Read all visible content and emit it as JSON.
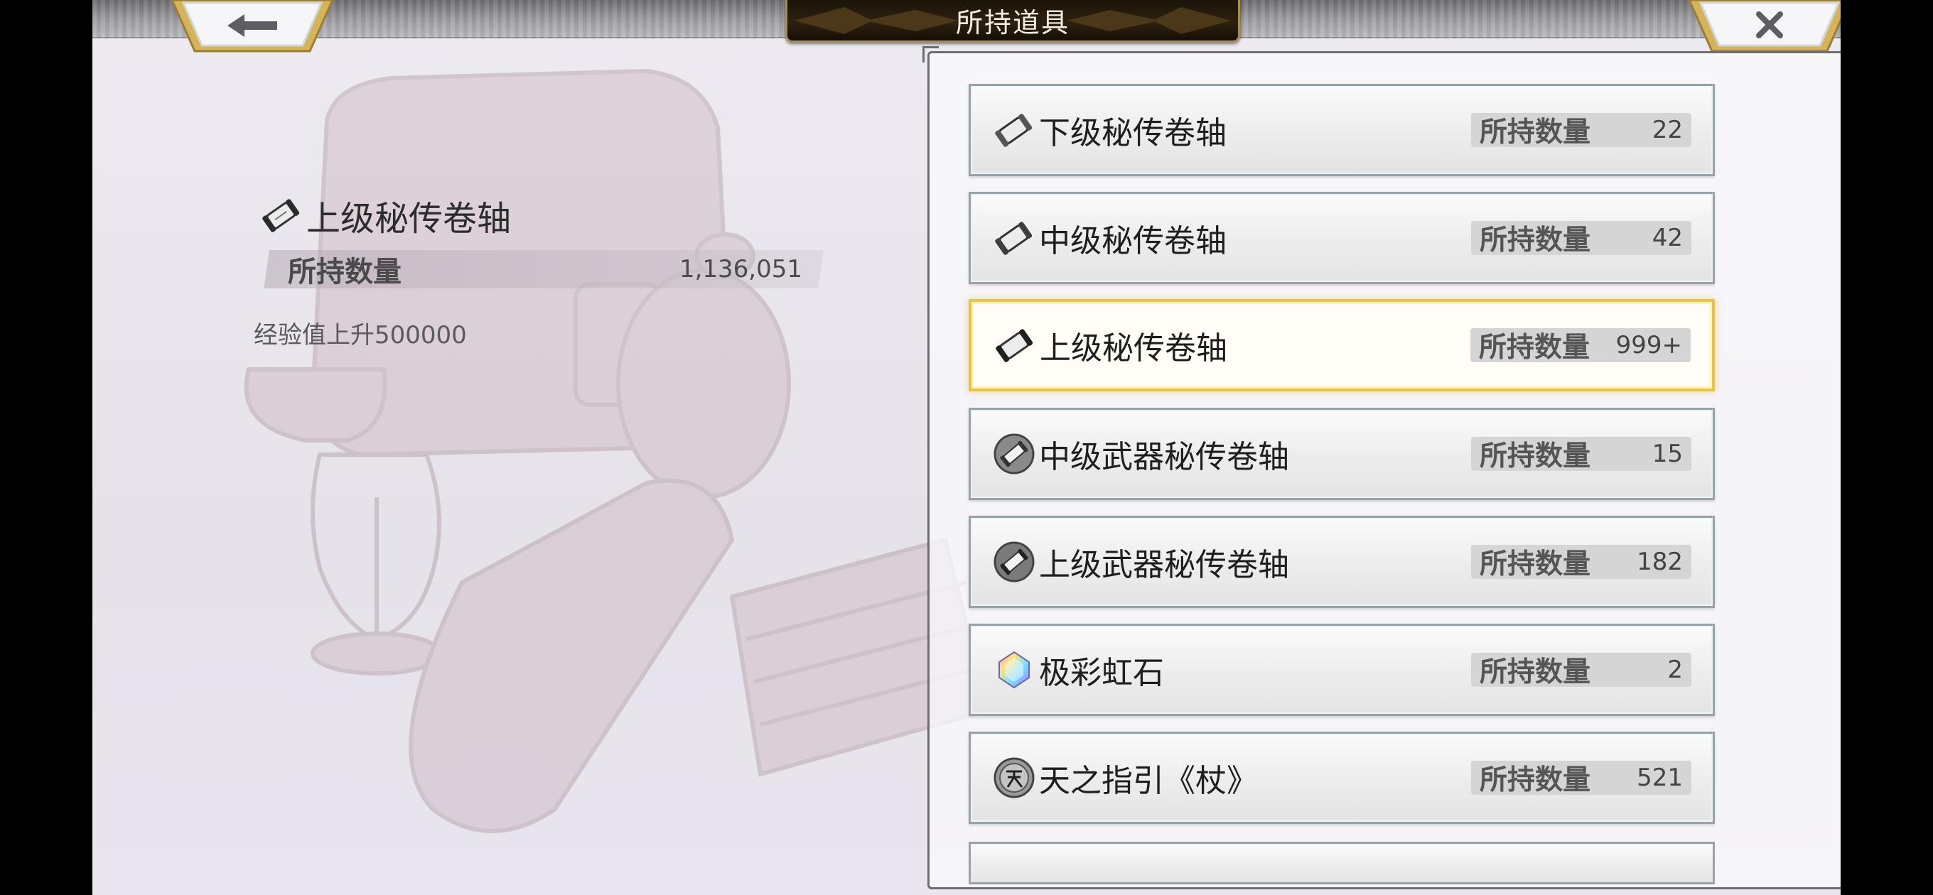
{
  "header": {
    "title": "所持道具",
    "back_icon": "back-arrow-icon",
    "close_icon": "close-x-icon"
  },
  "detail": {
    "icon": "scroll-icon",
    "name": "上级秘传卷轴",
    "qty_label": "所持数量",
    "qty_value": "1,136,051",
    "description": "经验值上升500000"
  },
  "items": [
    {
      "icon": "scroll-icon",
      "name": "下级秘传卷轴",
      "qty_label": "所持数量",
      "qty": "22"
    },
    {
      "icon": "scroll-icon",
      "name": "中级秘传卷轴",
      "qty_label": "所持数量",
      "qty": "42"
    },
    {
      "icon": "scroll-icon",
      "name": "上级秘传卷轴",
      "qty_label": "所持数量",
      "qty": "999+",
      "selected": true
    },
    {
      "icon": "weapon-scroll-icon",
      "name": "中级武器秘传卷轴",
      "qty_label": "所持数量",
      "qty": "15"
    },
    {
      "icon": "weapon-scroll-icon",
      "name": "上级武器秘传卷轴",
      "qty_label": "所持数量",
      "qty": "182"
    },
    {
      "icon": "rainbow-gem-icon",
      "name": "极彩虹石",
      "qty_label": "所持数量",
      "qty": "2"
    },
    {
      "icon": "heaven-seal-icon",
      "name": "天之指引《杖》",
      "qty_label": "所持数量",
      "qty": "521"
    }
  ],
  "colors": {
    "selected_border": "#e6c24e",
    "title_plate": "#2e2110",
    "frame": "#6d6d72"
  }
}
